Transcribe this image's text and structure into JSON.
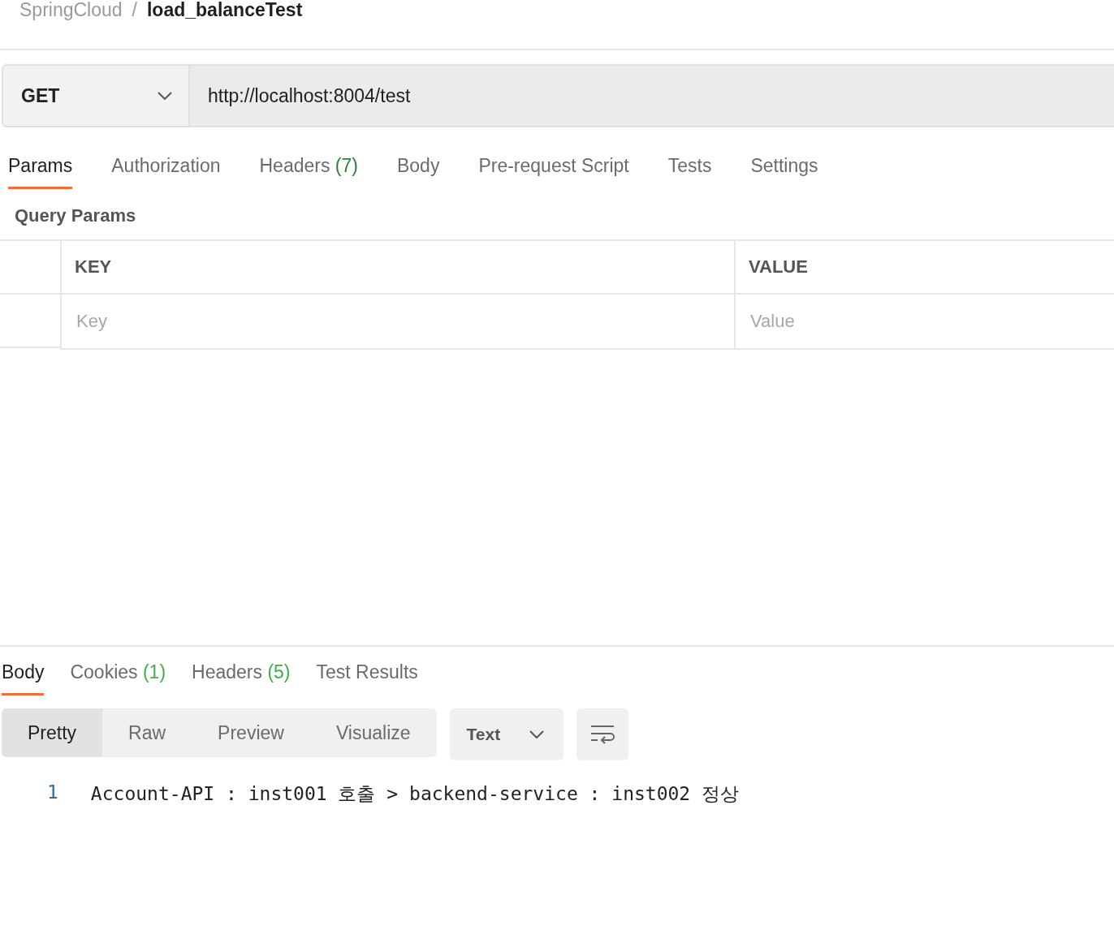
{
  "breadcrumb": {
    "collection": "SpringCloud",
    "separator": "/",
    "request": "load_balanceTest"
  },
  "request": {
    "method": "GET",
    "url": "http://localhost:8004/test"
  },
  "request_tabs": [
    {
      "label": "Params",
      "selected": true
    },
    {
      "label": "Authorization",
      "selected": false
    },
    {
      "label": "Headers",
      "count": "(7)",
      "selected": false
    },
    {
      "label": "Body",
      "selected": false
    },
    {
      "label": "Pre-request Script",
      "selected": false
    },
    {
      "label": "Tests",
      "selected": false
    },
    {
      "label": "Settings",
      "selected": false
    }
  ],
  "query_params": {
    "title": "Query Params",
    "columns": [
      "KEY",
      "VALUE"
    ],
    "placeholders": [
      "Key",
      "Value"
    ]
  },
  "response_tabs": [
    {
      "label": "Body",
      "selected": true
    },
    {
      "label": "Cookies",
      "count": "(1)",
      "selected": false
    },
    {
      "label": "Headers",
      "count": "(5)",
      "selected": false
    },
    {
      "label": "Test Results",
      "selected": false
    }
  ],
  "view_modes": [
    {
      "label": "Pretty",
      "selected": true
    },
    {
      "label": "Raw",
      "selected": false
    },
    {
      "label": "Preview",
      "selected": false
    },
    {
      "label": "Visualize",
      "selected": false
    }
  ],
  "format": "Text",
  "response_lines": [
    {
      "number": "1",
      "text": "Account-API : inst001 호출 > backend-service : inst002 정상"
    }
  ]
}
